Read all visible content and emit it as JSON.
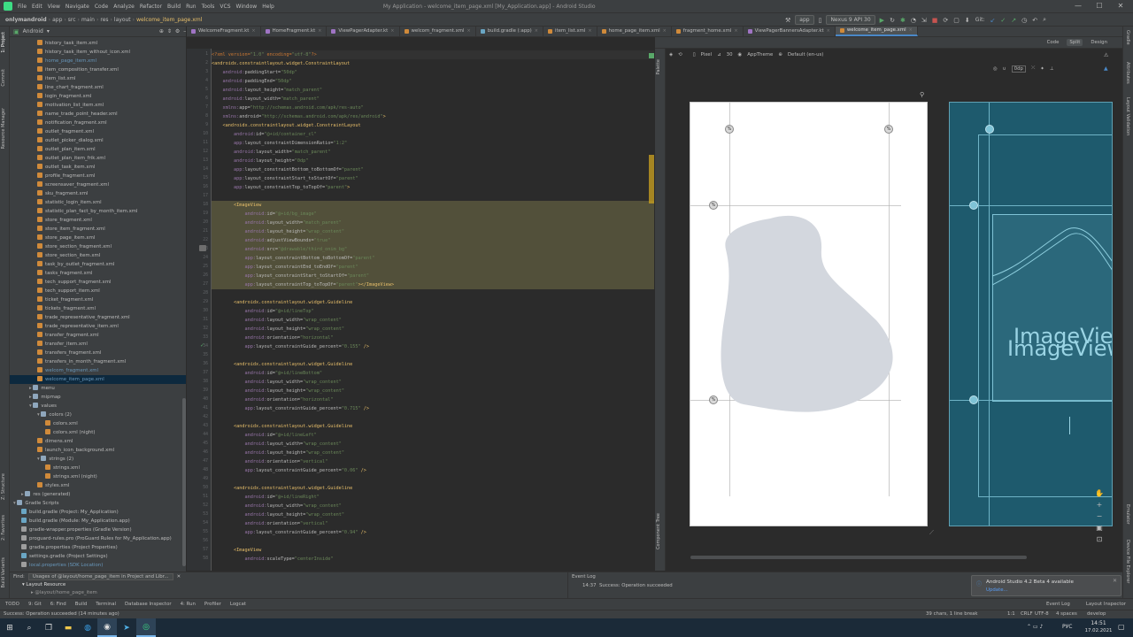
{
  "menubar": {
    "items": [
      "File",
      "Edit",
      "View",
      "Navigate",
      "Code",
      "Analyze",
      "Refactor",
      "Build",
      "Run",
      "Tools",
      "VCS",
      "Window",
      "Help"
    ],
    "window_title": "My Application - welcome_item_page.xml [My_Application.app] - Android Studio",
    "minimize": "—",
    "maximize": "☐",
    "close": "✕"
  },
  "breadcrumbs": [
    "onlymandroid",
    "app",
    "src",
    "main",
    "res",
    "layout",
    "welcome_item_page.xml"
  ],
  "toolbar": {
    "run_config": "app",
    "device": "Nexus 9 API 30",
    "git_label": "Git:"
  },
  "project_panel": {
    "view_mode": "Android",
    "rows": [
      {
        "t": "history_task_item.xml",
        "d": 3,
        "k": "x"
      },
      {
        "t": "history_task_item_without_icon.xml",
        "d": 3,
        "k": "x"
      },
      {
        "t": "home_page_item.xml",
        "d": 3,
        "k": "xb"
      },
      {
        "t": "item_composition_transfer.xml",
        "d": 3,
        "k": "x"
      },
      {
        "t": "item_list.xml",
        "d": 3,
        "k": "x"
      },
      {
        "t": "line_chart_fragment.xml",
        "d": 3,
        "k": "x"
      },
      {
        "t": "login_fragment.xml",
        "d": 3,
        "k": "x"
      },
      {
        "t": "motivation_list_item.xml",
        "d": 3,
        "k": "x"
      },
      {
        "t": "name_trade_point_header.xml",
        "d": 3,
        "k": "x"
      },
      {
        "t": "notification_fragment.xml",
        "d": 3,
        "k": "x"
      },
      {
        "t": "outlet_fragment.xml",
        "d": 3,
        "k": "x"
      },
      {
        "t": "outlet_picker_dialog.xml",
        "d": 3,
        "k": "x"
      },
      {
        "t": "outlet_plan_item.xml",
        "d": 3,
        "k": "x"
      },
      {
        "t": "outlet_plan_item_frik.xml",
        "d": 3,
        "k": "x"
      },
      {
        "t": "outlet_task_item.xml",
        "d": 3,
        "k": "x"
      },
      {
        "t": "profile_fragment.xml",
        "d": 3,
        "k": "x"
      },
      {
        "t": "screensaver_fragment.xml",
        "d": 3,
        "k": "x"
      },
      {
        "t": "sku_fragment.xml",
        "d": 3,
        "k": "x"
      },
      {
        "t": "statistic_login_item.xml",
        "d": 3,
        "k": "x"
      },
      {
        "t": "statistic_plan_fact_by_month_item.xml",
        "d": 3,
        "k": "x"
      },
      {
        "t": "store_fragment.xml",
        "d": 3,
        "k": "x"
      },
      {
        "t": "store_item_fragment.xml",
        "d": 3,
        "k": "x"
      },
      {
        "t": "store_page_item.xml",
        "d": 3,
        "k": "x"
      },
      {
        "t": "store_section_fragment.xml",
        "d": 3,
        "k": "x"
      },
      {
        "t": "store_section_item.xml",
        "d": 3,
        "k": "x"
      },
      {
        "t": "task_by_outlet_fragment.xml",
        "d": 3,
        "k": "x"
      },
      {
        "t": "tasks_fragment.xml",
        "d": 3,
        "k": "x"
      },
      {
        "t": "tech_support_fragment.xml",
        "d": 3,
        "k": "x"
      },
      {
        "t": "tech_support_item.xml",
        "d": 3,
        "k": "x"
      },
      {
        "t": "ticket_fragment.xml",
        "d": 3,
        "k": "x"
      },
      {
        "t": "tickets_fragment.xml",
        "d": 3,
        "k": "x"
      },
      {
        "t": "trade_representative_fragment.xml",
        "d": 3,
        "k": "x"
      },
      {
        "t": "trade_representative_item.xml",
        "d": 3,
        "k": "x"
      },
      {
        "t": "transfer_fragment.xml",
        "d": 3,
        "k": "x"
      },
      {
        "t": "transfer_item.xml",
        "d": 3,
        "k": "x"
      },
      {
        "t": "transfers_fragment.xml",
        "d": 3,
        "k": "x"
      },
      {
        "t": "transfers_in_month_fragment.xml",
        "d": 3,
        "k": "x"
      },
      {
        "t": "welcom_fragment.xml",
        "d": 3,
        "k": "xb"
      },
      {
        "t": "welcome_item_page.xml",
        "d": 3,
        "k": "xb",
        "sel": true
      },
      {
        "t": "menu",
        "d": 2,
        "k": "f"
      },
      {
        "t": "mipmap",
        "d": 2,
        "k": "f"
      },
      {
        "t": "values",
        "d": 2,
        "k": "fo"
      },
      {
        "t": "colors (2)",
        "d": 3,
        "k": "fo"
      },
      {
        "t": "colors.xml",
        "d": 4,
        "k": "x"
      },
      {
        "t": "colors.xml (night)",
        "d": 4,
        "k": "x"
      },
      {
        "t": "dimens.xml",
        "d": 3,
        "k": "x"
      },
      {
        "t": "launch_icon_background.xml",
        "d": 3,
        "k": "x"
      },
      {
        "t": "strings (2)",
        "d": 3,
        "k": "fo"
      },
      {
        "t": "strings.xml",
        "d": 4,
        "k": "x"
      },
      {
        "t": "strings.xml (night)",
        "d": 4,
        "k": "x"
      },
      {
        "t": "styles.xml",
        "d": 3,
        "k": "x"
      },
      {
        "t": "res (generated)",
        "d": 1,
        "k": "f"
      },
      {
        "t": "Gradle Scripts",
        "d": 0,
        "k": "fo"
      },
      {
        "t": "build.gradle (Project: My_Application)",
        "d": 1,
        "k": "g"
      },
      {
        "t": "build.gradle (Module: My_Application.app)",
        "d": 1,
        "k": "g"
      },
      {
        "t": "gradle-wrapper.properties (Gradle Version)",
        "d": 1,
        "k": "p"
      },
      {
        "t": "proguard-rules.pro (ProGuard Rules for My_Application.app)",
        "d": 1,
        "k": "p"
      },
      {
        "t": "gradle.properties (Project Properties)",
        "d": 1,
        "k": "p"
      },
      {
        "t": "settings.gradle (Project Settings)",
        "d": 1,
        "k": "g"
      },
      {
        "t": "local.properties (SDK Location)",
        "d": 1,
        "k": "pb"
      }
    ]
  },
  "tabs": [
    {
      "label": "WelcomeFragment.kt",
      "k": "kt"
    },
    {
      "label": "HomeFragment.kt",
      "k": "kt"
    },
    {
      "label": "ViewPagerAdapter.kt",
      "k": "kt"
    },
    {
      "label": "welcom_fragment.xml",
      "k": "xml"
    },
    {
      "label": "build.gradle (:app)",
      "k": "gr"
    },
    {
      "label": "item_list.xml",
      "k": "xml"
    },
    {
      "label": "home_page_item.xml",
      "k": "xml"
    },
    {
      "label": "fragment_home.xml",
      "k": "xml"
    },
    {
      "label": "ViewPagerBannersAdapter.kt",
      "k": "kt"
    },
    {
      "label": "welcome_item_page.xml",
      "k": "xml",
      "active": true
    }
  ],
  "design_modes": {
    "code": "Code",
    "split": "Split",
    "design": "Design"
  },
  "design_toolbar": {
    "device": "Pixel",
    "api": "30",
    "theme": "AppTheme",
    "locale": "Default (en-us)",
    "dp": "0dp"
  },
  "code_lines": [
    {
      "n": "1",
      "h": "<span class=\"pi\">&lt;?xml version=</span><span class=\"val\">\"1.0\"</span><span class=\"pi\"> encoding=</span><span class=\"val\">\"utf-8\"</span><span class=\"pi\">?&gt;</span>",
      "c": "cur"
    },
    {
      "n": "2",
      "h": "<span class=\"tag\">&lt;androidx.constraintlayout.widget.ConstraintLayout</span>"
    },
    {
      "n": "3",
      "h": "    <span class=\"ns\">android:</span><span class=\"attr\">paddingStart=</span><span class=\"val\">\"50dp\"</span>"
    },
    {
      "n": "4",
      "h": "    <span class=\"ns\">android:</span><span class=\"attr\">paddingEnd=</span><span class=\"val\">\"50dp\"</span>"
    },
    {
      "n": "5",
      "h": "    <span class=\"ns\">android:</span><span class=\"attr\">layout_height=</span><span class=\"val\">\"match_parent\"</span>"
    },
    {
      "n": "6",
      "h": "    <span class=\"ns\">android:</span><span class=\"attr\">layout_width=</span><span class=\"val\">\"match_parent\"</span>"
    },
    {
      "n": "7",
      "h": "    <span class=\"ns\">xmlns:</span><span class=\"attr\">app=</span><span class=\"val\">\"http://schemas.android.com/apk/res-auto\"</span>"
    },
    {
      "n": "8",
      "h": "    <span class=\"ns\">xmlns:</span><span class=\"attr\">android=</span><span class=\"val\">\"http://schemas.android.com/apk/res/android\"</span><span class=\"tag\">&gt;</span>"
    },
    {
      "n": "9",
      "h": "    <span class=\"tag\">&lt;androidx.constraintlayout.widget.ConstraintLayout</span>"
    },
    {
      "n": "10",
      "h": "        <span class=\"ns\">android:</span><span class=\"attr\">id=</span><span class=\"val\">\"@+id/container_cl\"</span>"
    },
    {
      "n": "11",
      "h": "        <span class=\"ns\">app:</span><span class=\"attr\">layout_constraintDimensionRatio=</span><span class=\"val\">\"1:2\"</span>"
    },
    {
      "n": "12",
      "h": "        <span class=\"ns\">android:</span><span class=\"attr\">layout_width=</span><span class=\"val\">\"match_parent\"</span>"
    },
    {
      "n": "13",
      "h": "        <span class=\"ns\">android:</span><span class=\"attr\">layout_height=</span><span class=\"val\">\"0dp\"</span>"
    },
    {
      "n": "14",
      "h": "        <span class=\"ns\">app:</span><span class=\"attr\">layout_constraintBottom_toBottomOf=</span><span class=\"val\">\"parent\"</span>"
    },
    {
      "n": "15",
      "h": "        <span class=\"ns\">app:</span><span class=\"attr\">layout_constraintStart_toStartOf=</span><span class=\"val\">\"parent\"</span>"
    },
    {
      "n": "16",
      "h": "        <span class=\"ns\">app:</span><span class=\"attr\">layout_constraintTop_toTopOf=</span><span class=\"val\">\"parent\"</span><span class=\"tag\">&gt;</span>"
    },
    {
      "n": "17",
      "h": ""
    },
    {
      "n": "18",
      "h": "        <span class=\"tag\">&lt;ImageView</span>",
      "c": "hl"
    },
    {
      "n": "19",
      "h": "            <span class=\"ns\">android:</span><span class=\"attr\">id=</span><span class=\"val\">\"@+id/bg_image\"</span>",
      "c": "hl"
    },
    {
      "n": "20",
      "h": "            <span class=\"ns\">android:</span><span class=\"attr\">layout_width=</span><span class=\"val\">\"match_parent\"</span>",
      "c": "hl"
    },
    {
      "n": "21",
      "h": "            <span class=\"ns\">android:</span><span class=\"attr\">layout_height=</span><span class=\"val\">\"wrap_content\"</span>",
      "c": "hl"
    },
    {
      "n": "22",
      "h": "            <span class=\"ns\">android:</span><span class=\"attr\">adjustViewBounds=</span><span class=\"val\">\"true\"</span>",
      "c": "hl"
    },
    {
      "n": "23",
      "h": "            <span class=\"ns\">android:</span><span class=\"attr\">src=</span><span class=\"val\">\"@drawable/third_onim_bg\"</span>",
      "c": "hl"
    },
    {
      "n": "24",
      "h": "            <span class=\"ns\">app:</span><span class=\"attr\">layout_constraintBottom_toBottomOf=</span><span class=\"val\">\"parent\"</span>",
      "c": "hl"
    },
    {
      "n": "25",
      "h": "            <span class=\"ns\">app:</span><span class=\"attr\">layout_constraintEnd_toEndOf=</span><span class=\"val\">\"parent\"</span>",
      "c": "hl"
    },
    {
      "n": "26",
      "h": "            <span class=\"ns\">app:</span><span class=\"attr\">layout_constraintStart_toStartOf=</span><span class=\"val\">\"parent\"</span>",
      "c": "hl"
    },
    {
      "n": "27",
      "h": "            <span class=\"ns\">app:</span><span class=\"attr\">layout_constraintTop_toTopOf=</span><span class=\"val\">\"parent\"</span><span class=\"tag\">&gt;&lt;/ImageView&gt;</span>",
      "c": "hl"
    },
    {
      "n": "28",
      "h": ""
    },
    {
      "n": "29",
      "h": "        <span class=\"tag\">&lt;androidx.constraintlayout.widget.Guideline</span>"
    },
    {
      "n": "30",
      "h": "            <span class=\"ns\">android:</span><span class=\"attr\">id=</span><span class=\"val\">\"@+id/lineTop\"</span>"
    },
    {
      "n": "31",
      "h": "            <span class=\"ns\">android:</span><span class=\"attr\">layout_width=</span><span class=\"val\">\"wrap_content\"</span>"
    },
    {
      "n": "32",
      "h": "            <span class=\"ns\">android:</span><span class=\"attr\">layout_height=</span><span class=\"val\">\"wrap_content\"</span>"
    },
    {
      "n": "33",
      "h": "            <span class=\"ns\">android:</span><span class=\"attr\">orientation=</span><span class=\"val\">\"horizontal\"</span>"
    },
    {
      "n": "34",
      "h": "            <span class=\"ns\">app:</span><span class=\"attr\">layout_constraintGuide_percent=</span><span class=\"val\">\"0.155\"</span><span class=\"tag\"> /&gt;</span>"
    },
    {
      "n": "35",
      "h": ""
    },
    {
      "n": "36",
      "h": "        <span class=\"tag\">&lt;androidx.constraintlayout.widget.Guideline</span>"
    },
    {
      "n": "37",
      "h": "            <span class=\"ns\">android:</span><span class=\"attr\">id=</span><span class=\"val\">\"@+id/lineBottom\"</span>"
    },
    {
      "n": "38",
      "h": "            <span class=\"ns\">android:</span><span class=\"attr\">layout_width=</span><span class=\"val\">\"wrap_content\"</span>"
    },
    {
      "n": "39",
      "h": "            <span class=\"ns\">android:</span><span class=\"attr\">layout_height=</span><span class=\"val\">\"wrap_content\"</span>"
    },
    {
      "n": "40",
      "h": "            <span class=\"ns\">android:</span><span class=\"attr\">orientation=</span><span class=\"val\">\"horizontal\"</span>"
    },
    {
      "n": "41",
      "h": "            <span class=\"ns\">app:</span><span class=\"attr\">layout_constraintGuide_percent=</span><span class=\"val\">\"0.715\"</span><span class=\"tag\"> /&gt;</span>"
    },
    {
      "n": "42",
      "h": ""
    },
    {
      "n": "43",
      "h": "        <span class=\"tag\">&lt;androidx.constraintlayout.widget.Guideline</span>"
    },
    {
      "n": "44",
      "h": "            <span class=\"ns\">android:</span><span class=\"attr\">id=</span><span class=\"val\">\"@+id/lineLeft\"</span>"
    },
    {
      "n": "45",
      "h": "            <span class=\"ns\">android:</span><span class=\"attr\">layout_width=</span><span class=\"val\">\"wrap_content\"</span>"
    },
    {
      "n": "46",
      "h": "            <span class=\"ns\">android:</span><span class=\"attr\">layout_height=</span><span class=\"val\">\"wrap_content\"</span>"
    },
    {
      "n": "47",
      "h": "            <span class=\"ns\">android:</span><span class=\"attr\">orientation=</span><span class=\"val\">\"vertical\"</span>"
    },
    {
      "n": "48",
      "h": "            <span class=\"ns\">app:</span><span class=\"attr\">layout_constraintGuide_percent=</span><span class=\"val\">\"0.06\"</span><span class=\"tag\"> /&gt;</span>"
    },
    {
      "n": "49",
      "h": ""
    },
    {
      "n": "50",
      "h": "        <span class=\"tag\">&lt;androidx.constraintlayout.widget.Guideline</span>"
    },
    {
      "n": "51",
      "h": "            <span class=\"ns\">android:</span><span class=\"attr\">id=</span><span class=\"val\">\"@+id/lineRight\"</span>"
    },
    {
      "n": "52",
      "h": "            <span class=\"ns\">android:</span><span class=\"attr\">layout_width=</span><span class=\"val\">\"wrap_content\"</span>"
    },
    {
      "n": "53",
      "h": "            <span class=\"ns\">android:</span><span class=\"attr\">layout_height=</span><span class=\"val\">\"wrap_content\"</span>"
    },
    {
      "n": "54",
      "h": "            <span class=\"ns\">android:</span><span class=\"attr\">orientation=</span><span class=\"val\">\"vertical\"</span>"
    },
    {
      "n": "55",
      "h": "            <span class=\"ns\">app:</span><span class=\"attr\">layout_constraintGuide_percent=</span><span class=\"val\">\"0.94\"</span><span class=\"tag\"> /&gt;</span>"
    },
    {
      "n": "56",
      "h": ""
    },
    {
      "n": "57",
      "h": "        <span class=\"tag\">&lt;ImageView</span>"
    },
    {
      "n": "58",
      "h": "            <span class=\"ns\">android:</span><span class=\"attr\">scaleType=</span><span class=\"val\">\"centerInside\"</span>"
    }
  ],
  "design": {
    "blueprint_text": "ImageView",
    "pct": "%"
  },
  "find": {
    "label": "Find:",
    "query": "Usages of @layout/home_page_item in Project and Libr...",
    "group": "Layout Resource",
    "result": "@layout/home_page_item"
  },
  "event_log": {
    "title": "Event Log",
    "time": "14:37",
    "message": "Success: Operation succeeded"
  },
  "notification": {
    "title": "Android Studio 4.2 Beta 4 available",
    "link": "Update..."
  },
  "bottom_tools": [
    "TODO",
    "9: Git",
    "6: Find",
    "Build",
    "Terminal",
    "Database Inspector",
    "4: Run",
    "Profiler",
    "Logcat"
  ],
  "bottom_right": [
    "Event Log",
    "Layout Inspector"
  ],
  "status": {
    "left": "Success: Operation succeeded (14 minutes ago)",
    "pos": "39 chars, 1 line break",
    "line": "1:1",
    "crlf": "CRLF",
    "enc": "UTF-8",
    "indent": "4 spaces",
    "branch": "develop"
  },
  "left_tools": [
    "1: Project",
    "Commit",
    "Resource Manager",
    "Z: Structure",
    "2: Favorites",
    "Build Variants"
  ],
  "right_tools": [
    "Gradle",
    "Attributes",
    "Layout Validation",
    "Emulator",
    "Device File Explorer"
  ],
  "design_left_tools": [
    "Palette",
    "Component Tree"
  ],
  "taskbar": {
    "clock": "14:51",
    "date": "17.02.2021",
    "lang": "РУС"
  }
}
